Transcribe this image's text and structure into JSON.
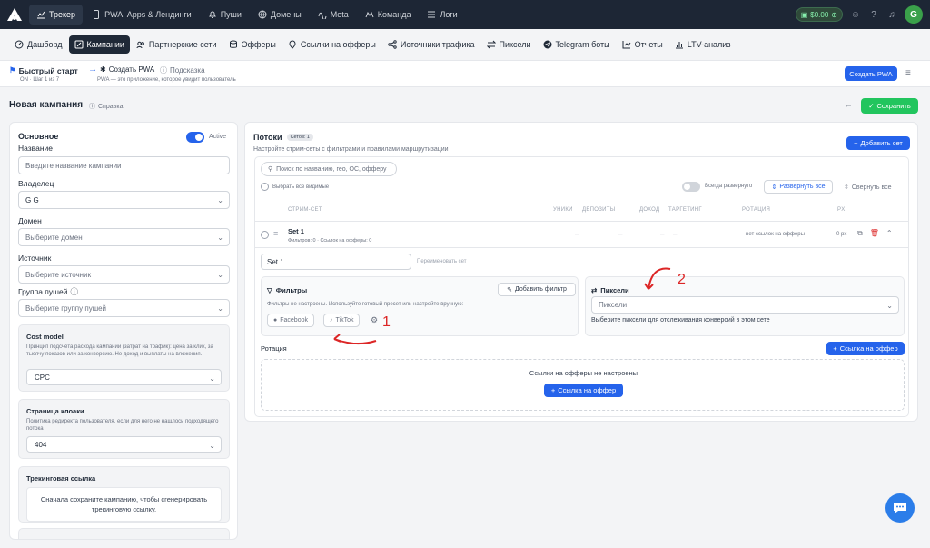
{
  "topnav": {
    "items": [
      {
        "label": "Трекер",
        "icon": "chart-icon",
        "active": true
      },
      {
        "label": "PWA, Apps & Лендинги",
        "icon": "phone-icon",
        "active": false
      },
      {
        "label": "Пуши",
        "icon": "bell-icon",
        "active": false
      },
      {
        "label": "Домены",
        "icon": "globe-icon",
        "active": false
      },
      {
        "label": "Meta",
        "icon": "meta-icon",
        "active": false
      },
      {
        "label": "Команда",
        "icon": "team-icon",
        "active": false
      },
      {
        "label": "Логи",
        "icon": "list-icon",
        "active": false
      }
    ],
    "balance": "$0.00",
    "avatar": "G"
  },
  "subnav": {
    "items": [
      {
        "label": "Дашборд",
        "active": false
      },
      {
        "label": "Кампании",
        "active": true
      },
      {
        "label": "Партнерские сети",
        "active": false
      },
      {
        "label": "Офферы",
        "active": false
      },
      {
        "label": "Ссылки на офферы",
        "active": false
      },
      {
        "label": "Источники трафика",
        "active": false
      },
      {
        "label": "Пиксели",
        "active": false
      },
      {
        "label": "Telegram боты",
        "active": false
      },
      {
        "label": "Отчеты",
        "active": false
      },
      {
        "label": "LTV-анализ",
        "active": false
      }
    ]
  },
  "breadcrumb": {
    "quickstart": "Быстрый старт",
    "quickstart_sub": "ON · Шаг 1 из 7",
    "create_pwa": "Создать PWA",
    "create_pwa_sub": "PWA — это приложение, которое увидит пользователь",
    "hint": "Подсказка",
    "create_pwa_button": "Создать PWA"
  },
  "header": {
    "title": "Новая кампания",
    "help": "Справка",
    "save": "Сохранить"
  },
  "basic": {
    "title": "Основное",
    "active_label": "Active",
    "name_label": "Название",
    "name_placeholder": "Введите название кампании",
    "owner_label": "Владелец",
    "owner_value": "G G",
    "domain_label": "Домен",
    "domain_placeholder": "Выберите домен",
    "source_label": "Источник",
    "source_placeholder": "Выберите источник",
    "push_label": "Группа пушей",
    "push_placeholder": "Выберите группу пушей",
    "cost_title": "Cost model",
    "cost_desc": "Принцип подсчёта расхода кампании (затрат на трафик): цена за клик, за тысячу показов или за конверсию. Не доход и выплаты на вложения.",
    "cost_value": "CPC",
    "cloak_title": "Страница клоаки",
    "cloak_desc": "Политика редиректа пользователя, если для него не нашлось подходящего потока",
    "cloak_value": "404",
    "tracking_title": "Трекинговая ссылка",
    "tracking_text": "Сначала сохраните кампанию, чтобы сгенерировать трекинговую ссылку."
  },
  "flows": {
    "title": "Потоки",
    "sets_count": "Сетов: 1",
    "desc": "Настройте стрим-сеты с фильтрами и правилами маршрутизации",
    "add_set": "Добавить сет",
    "search_placeholder": "Поиск по названию, гео, ОС, офферу",
    "select_all": "Выбрать все видимые",
    "always_expand": "Всегда развернуто",
    "expand_all": "Развернуть все",
    "collapse_all": "Свернуть все",
    "columns": [
      "СТРИМ-СЕТ",
      "УНИКИ",
      "ДЕПОЗИТЫ",
      "ДОХОД",
      "ТАРГЕТИНГ",
      "РОТАЦИЯ",
      "PX"
    ],
    "set": {
      "name": "Set 1",
      "meta": "Фильтров: 0 · Ссылок на офферы: 0",
      "uniques": "–",
      "deposits": "–",
      "income": "–",
      "targeting": "–",
      "rotation": "нет ссылок на офферы",
      "px": "0 px",
      "input_value": "Set 1",
      "rename_hint": "Переименовать сет"
    },
    "filters": {
      "title": "Фильтры",
      "add": "Добавить фильтр",
      "desc": "Фильтры не настроены. Используйте готовый пресет или настройте вручную:",
      "chips": [
        "Facebook",
        "TikTok"
      ]
    },
    "pixels": {
      "title": "Пиксели",
      "placeholder": "Пиксели",
      "desc": "Выберите пиксели для отслеживания конверсий в этом сете"
    },
    "rotation": {
      "title": "Ротация",
      "add_offer": "Ссылка на оффер",
      "empty": "Ссылки на офферы не настроены",
      "add_offer_center": "Ссылка на оффер"
    }
  },
  "annotations": {
    "one": "1",
    "two": "2"
  },
  "colors": {
    "nav_bg": "#1d2635",
    "accent": "#2563eb",
    "save": "#22c55e",
    "annotation": "#dc2626"
  }
}
